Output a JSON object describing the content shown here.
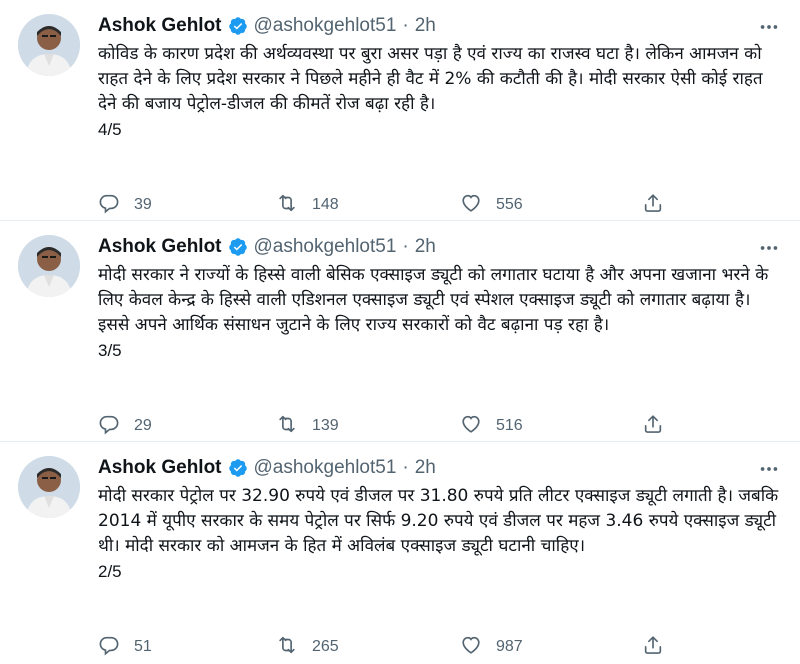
{
  "tweets": [
    {
      "name": "Ashok Gehlot",
      "handle": "@ashokgehlot51",
      "separator": "·",
      "time": "2h",
      "text": "कोविड के कारण प्रदेश की अर्थव्यवस्था पर बुरा असर पड़ा है एवं राज्य का राजस्व घटा है। लेकिन आमजन को राहत देने के लिए प्रदेश सरकार ने पिछले महीने ही वैट में 2% की कटौती की है। मोदी सरकार ऐसी कोई राहत देने की बजाय पेट्रोल-डीजल की कीमतें रोज बढ़ा रही है।",
      "counter": "4/5",
      "replies": "39",
      "retweets": "148",
      "likes": "556"
    },
    {
      "name": "Ashok Gehlot",
      "handle": "@ashokgehlot51",
      "separator": "·",
      "time": "2h",
      "text": "मोदी सरकार ने राज्यों के हिस्से वाली बेसिक एक्साइज ड्यूटी को लगातार घटाया है और अपना खजाना भरने के लिए केवल केन्द्र के हिस्से वाली एडिशनल एक्साइज ड्यूटी एवं स्पेशल एक्साइज ड्यूटी को लगातार बढ़ाया है।इससे अपने आर्थिक संसाधन जुटाने के लिए राज्य सरकारों को वैट बढ़ाना पड़ रहा है।",
      "counter": "3/5",
      "replies": "29",
      "retweets": "139",
      "likes": "516"
    },
    {
      "name": "Ashok Gehlot",
      "handle": "@ashokgehlot51",
      "separator": "·",
      "time": "2h",
      "text": "मोदी सरकार पेट्रोल पर 32.90 रुपये एवं डीजल पर 31.80 रुपये प्रति लीटर एक्साइज ड्यूटी लगाती है। जबकि 2014 में यूपीए सरकार के समय पेट्रोल पर सिर्फ 9.20 रुपये एवं डीजल पर महज 3.46 रुपये एक्साइज ड्यूटी थी। मोदी सरकार को आमजन के हित में अविलंब एक्साइज ड्यूटी घटानी चाहिए।",
      "counter": "2/5",
      "replies": "51",
      "retweets": "265",
      "likes": "987"
    }
  ],
  "icons": {
    "verified": "verified-badge-icon",
    "more": "more-options-icon",
    "reply": "reply-icon",
    "retweet": "retweet-icon",
    "like": "heart-icon",
    "share": "share-icon"
  },
  "colors": {
    "verified": "#1d9bf0",
    "muted": "#536471",
    "text": "#0f1419"
  }
}
